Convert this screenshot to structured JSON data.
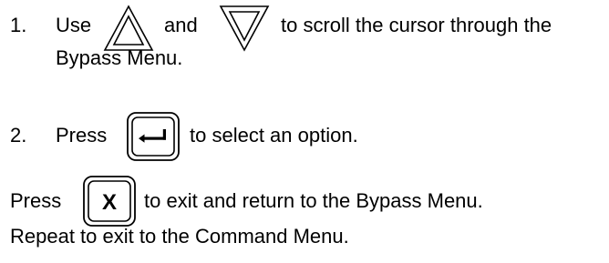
{
  "steps": [
    {
      "number": "1.",
      "part1": "Use",
      "part2": "and",
      "part3": "to scroll the cursor through the",
      "line2": "Bypass Menu."
    },
    {
      "number": "2.",
      "part1": "Press",
      "part2": "to select an option."
    }
  ],
  "note": {
    "part1": "Press",
    "part2": "to exit and return to the Bypass Menu.",
    "line2": "Repeat to exit to the Command Menu."
  },
  "keys": {
    "up": "up-arrow-key-icon",
    "down": "down-arrow-key-icon",
    "enter": "enter-key-icon",
    "exit_label": "X"
  }
}
